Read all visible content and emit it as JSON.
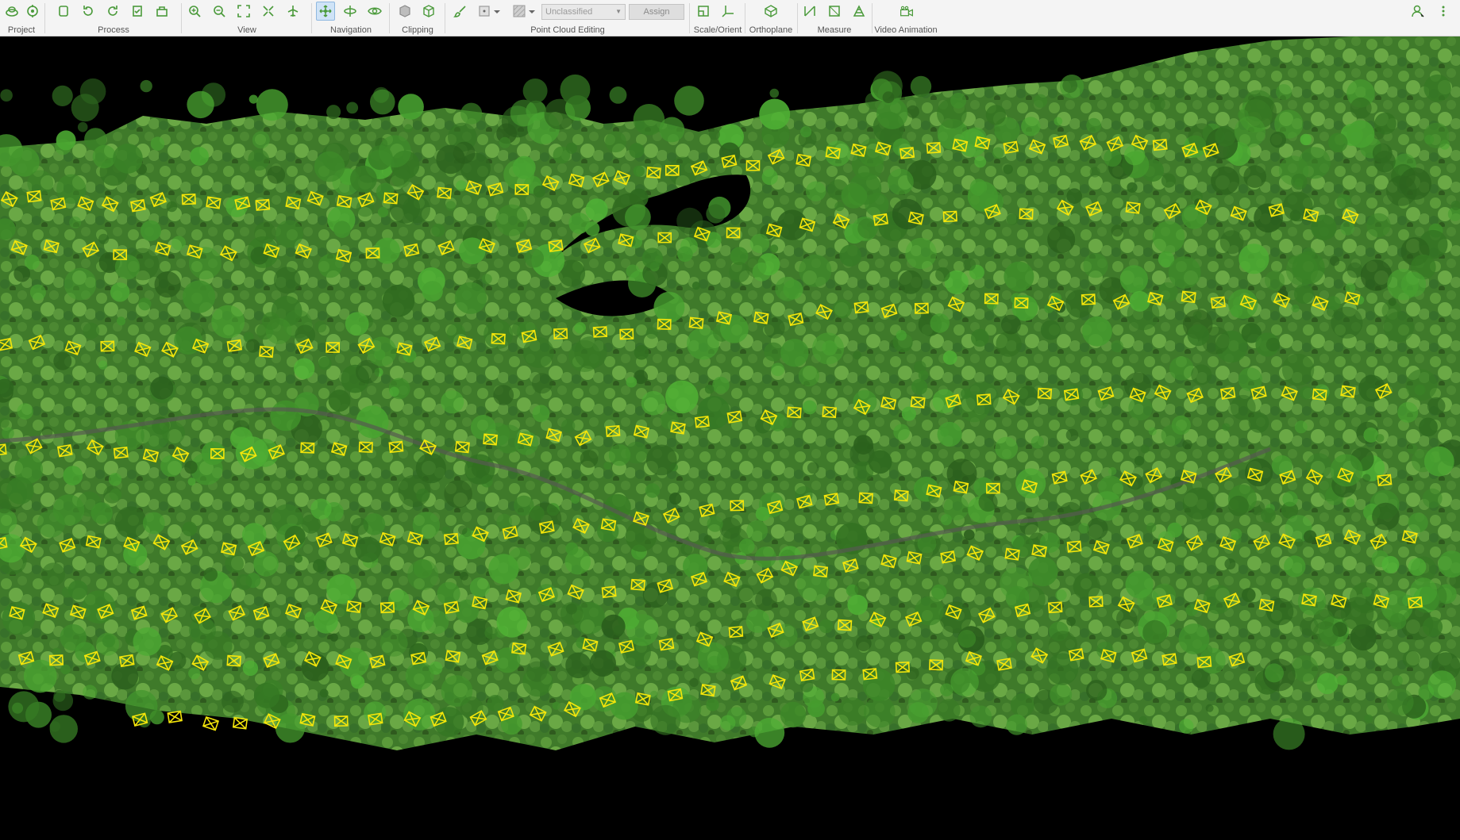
{
  "toolbar": {
    "groups": [
      {
        "label": "Project"
      },
      {
        "label": "Process"
      },
      {
        "label": "View"
      },
      {
        "label": "Navigation"
      },
      {
        "label": "Clipping"
      },
      {
        "label": "Point Cloud Editing"
      },
      {
        "label": "Scale/Orient"
      },
      {
        "label": "Orthoplane"
      },
      {
        "label": "Measure"
      },
      {
        "label": "Video Animation"
      }
    ],
    "class_select": {
      "value": "Unclassified"
    },
    "assign_label": "Assign"
  },
  "icons": {
    "project": [
      "open-project-icon",
      "target-icon"
    ],
    "process": [
      "new-icon",
      "refresh-icon",
      "reprocess-icon",
      "check-icon",
      "bag-icon"
    ],
    "view": [
      "zoom-in-icon",
      "zoom-out-icon",
      "fit-all-icon",
      "shrink-icon",
      "airplane-icon"
    ],
    "navigation": [
      "pan-move-icon",
      "orbit-icon",
      "eye-icon"
    ],
    "clipping": [
      "box-clip-icon",
      "box-icon"
    ],
    "editing": [
      "brush-icon",
      "select-point-icon",
      "dropdown-icon",
      "pattern-icon",
      "dropdown-icon"
    ],
    "scale": [
      "scale-icon",
      "axis-icon"
    ],
    "ortho": [
      "orthoplane-icon"
    ],
    "measure": [
      "measure-line-icon",
      "measure-area-icon",
      "measure-volume-icon"
    ],
    "video": [
      "camera-icon"
    ],
    "right": [
      "user-icon",
      "more-icon"
    ]
  },
  "colors": {
    "accent_green": "#4a9a3a",
    "camera_marker": "#f5e60a",
    "canopy_dark": "#2f5a1e",
    "canopy_light": "#7fb04a",
    "background": "#000000"
  }
}
